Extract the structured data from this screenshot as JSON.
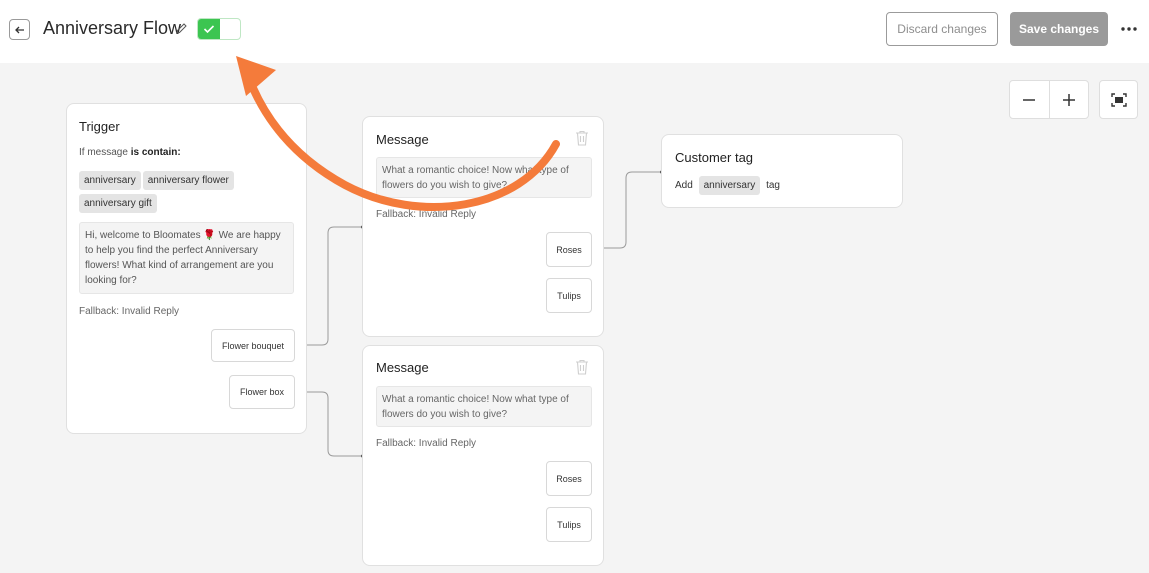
{
  "header": {
    "title": "Anniversary Flow",
    "discard_label": "Discard changes",
    "save_label": "Save changes",
    "toggle_on": true
  },
  "trigger": {
    "title": "Trigger",
    "condition_prefix": "If message",
    "condition_bold": "is contain:",
    "keywords": [
      "anniversary",
      "anniversary flower",
      "anniversary gift"
    ],
    "message": "Hi, welcome to Bloomates 🌹 We are happy to help you find the perfect Anniversary flowers! What kind of arrangement are you looking for?",
    "fallback": "Fallback: Invalid Reply",
    "buttons": [
      "Flower bouquet",
      "Flower box"
    ]
  },
  "message_1": {
    "title": "Message",
    "text": "What a romantic choice! Now what type of flowers do you wish to give?",
    "fallback": "Fallback: Invalid Reply",
    "buttons": [
      "Roses",
      "Tulips"
    ]
  },
  "message_2": {
    "title": "Message",
    "text": "What a romantic choice! Now what type of flowers do you wish to give?",
    "fallback": "Fallback: Invalid Reply",
    "buttons": [
      "Roses",
      "Tulips"
    ]
  },
  "customer_tag": {
    "title": "Customer tag",
    "prefix": "Add",
    "tag": "anniversary",
    "suffix": "tag"
  },
  "colors": {
    "accent_arrow": "#f47b3b",
    "toggle_green": "#3cc551",
    "save_button": "#9a9a9a"
  }
}
